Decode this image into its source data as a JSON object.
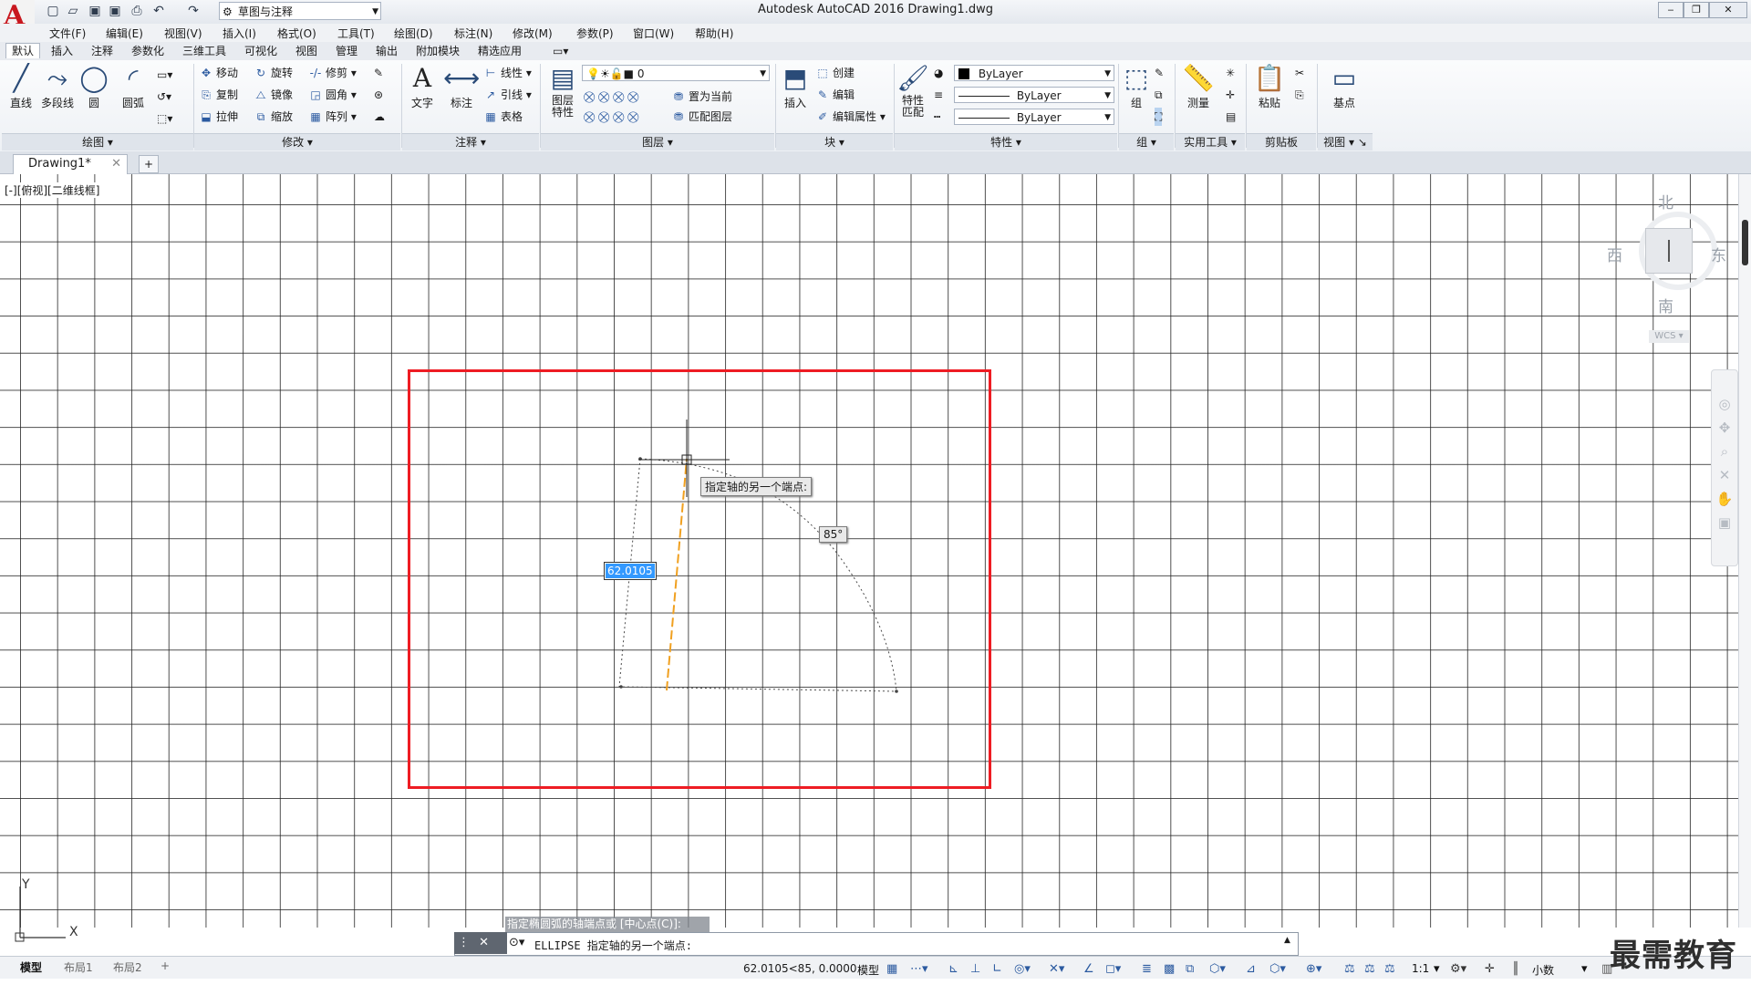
{
  "window": {
    "title": "Autodesk AutoCAD 2016    Drawing1.dwg",
    "workspace": "草图与注释"
  },
  "menu": [
    "文件(F)",
    "编辑(E)",
    "视图(V)",
    "插入(I)",
    "格式(O)",
    "工具(T)",
    "绘图(D)",
    "标注(N)",
    "修改(M)",
    "参数(P)",
    "窗口(W)",
    "帮助(H)"
  ],
  "ribbon_tabs": [
    "默认",
    "插入",
    "注释",
    "参数化",
    "三维工具",
    "可视化",
    "视图",
    "管理",
    "输出",
    "附加模块",
    "精选应用"
  ],
  "ribbon": {
    "draw": {
      "title": "绘图",
      "line": "直线",
      "polyline": "多段线",
      "circle": "圆",
      "arc": "圆弧"
    },
    "modify": {
      "title": "修改",
      "move": "移动",
      "rotate": "旋转",
      "trim": "修剪",
      "copy": "复制",
      "mirror": "镜像",
      "fillet": "圆角",
      "stretch": "拉伸",
      "scale": "缩放",
      "array": "阵列"
    },
    "annotation": {
      "title": "注释",
      "text": "文字",
      "dimension": "标注",
      "linear": "线性",
      "leader": "引线",
      "table": "表格"
    },
    "layers": {
      "title": "图层",
      "properties": "图层\n特性",
      "current_layer": "0",
      "set_current": "置为当前",
      "match_layer": "匹配图层"
    },
    "block": {
      "title": "块",
      "insert": "插入",
      "create": "创建",
      "edit": "编辑",
      "edit_attr": "编辑属性"
    },
    "properties": {
      "title": "特性",
      "match": "特性\n匹配",
      "color": "ByLayer",
      "linetype": "ByLayer",
      "lineweight": "ByLayer"
    },
    "groups": {
      "title": "组",
      "group": "组"
    },
    "utilities": {
      "title": "实用工具",
      "measure": "测量"
    },
    "clipboard": {
      "title": "剪贴板",
      "paste": "粘贴"
    },
    "view": {
      "title": "视图",
      "base": "基点"
    }
  },
  "doc_tab": "Drawing1*",
  "viewport_label": "[-][俯视][二维线框]",
  "viewcube": {
    "north": "北",
    "south": "南",
    "east": "东",
    "west": "西",
    "wcs": "WCS"
  },
  "drawing": {
    "tooltip": "指定轴的另一个端点:",
    "angle": "85°",
    "dim_value": "62.0105"
  },
  "command": {
    "history": "指定椭圆弧的轴端点或 [中心点(C)]:",
    "current": "ELLIPSE 指定轴的另一个端点:"
  },
  "layout_tabs": [
    "模型",
    "布局1",
    "布局2"
  ],
  "status": {
    "coords": "62.0105<85, 0.0000",
    "model": "模型",
    "scale": "1:1",
    "units": "小数"
  },
  "watermark": "最需教育",
  "colors": {
    "highlight_rect": "#ee1c23",
    "rubberband": "#f0a020",
    "dim_select": "#3399ff"
  }
}
